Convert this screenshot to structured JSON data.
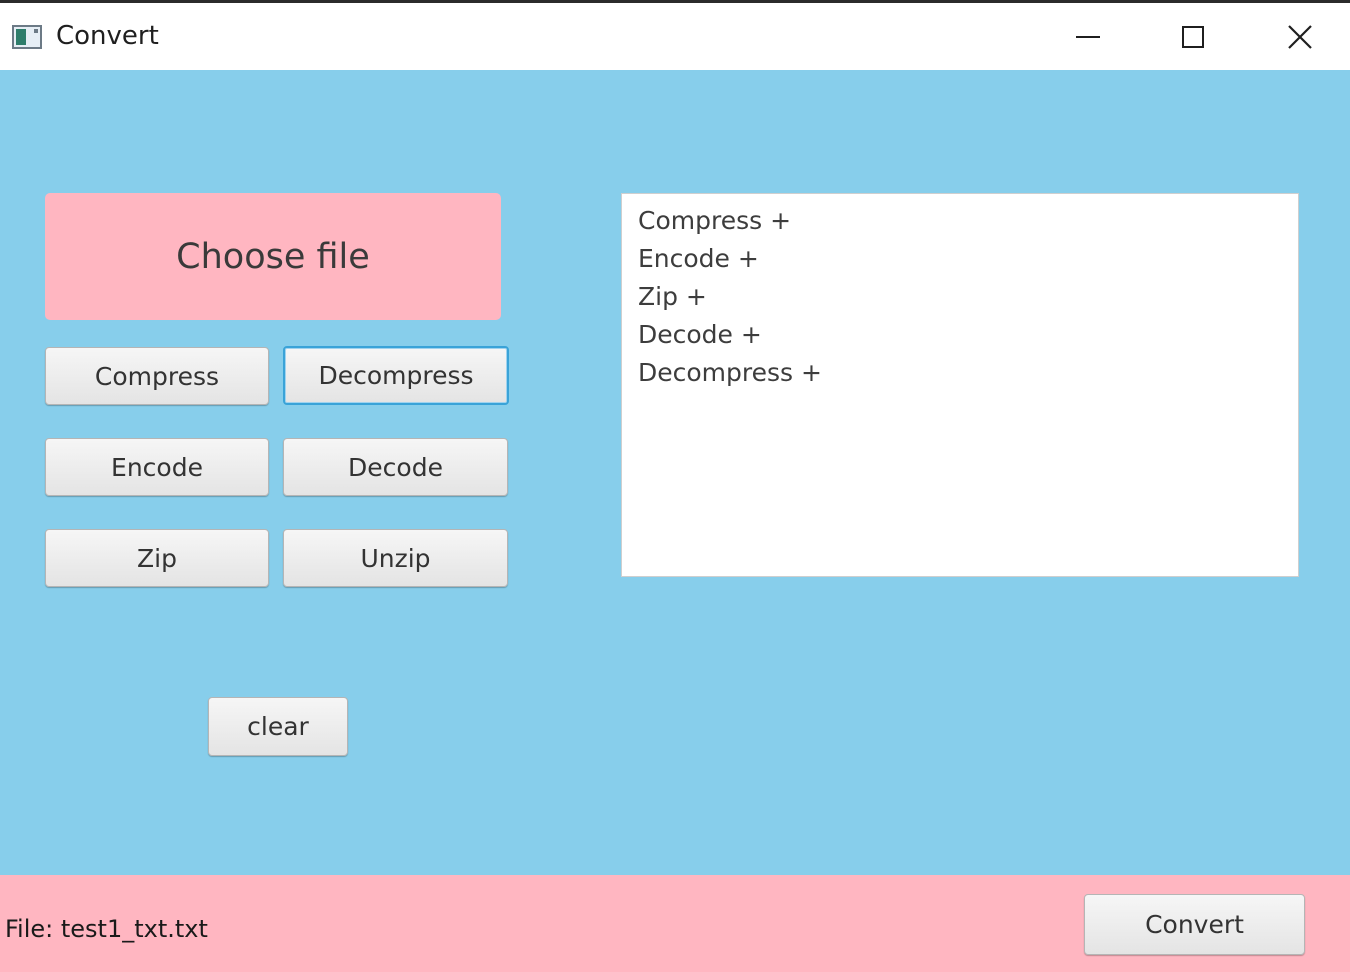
{
  "window": {
    "title": "Convert",
    "icon": "app-window-icon"
  },
  "titlebar_controls": {
    "minimize_icon": "minimize-icon",
    "maximize_icon": "maximize-icon",
    "close_icon": "close-icon"
  },
  "left_panel": {
    "choose_file_label": "Choose file",
    "buttons": {
      "compress": "Compress",
      "decompress": "Decompress",
      "encode": "Encode",
      "decode": "Decode",
      "zip": "Zip",
      "unzip": "Unzip",
      "clear": "clear"
    },
    "focused_button": "Decompress"
  },
  "operations_list": {
    "items": [
      "Compress +",
      "Encode +",
      "Zip +",
      "Decode +",
      "Decompress +"
    ]
  },
  "status_bar": {
    "file_label": "File: test1_txt.txt",
    "convert_label": "Convert"
  },
  "colors": {
    "background": "#87CEEB",
    "accent_pink": "#FFB6C1",
    "focus_border": "#3aa3d8"
  }
}
